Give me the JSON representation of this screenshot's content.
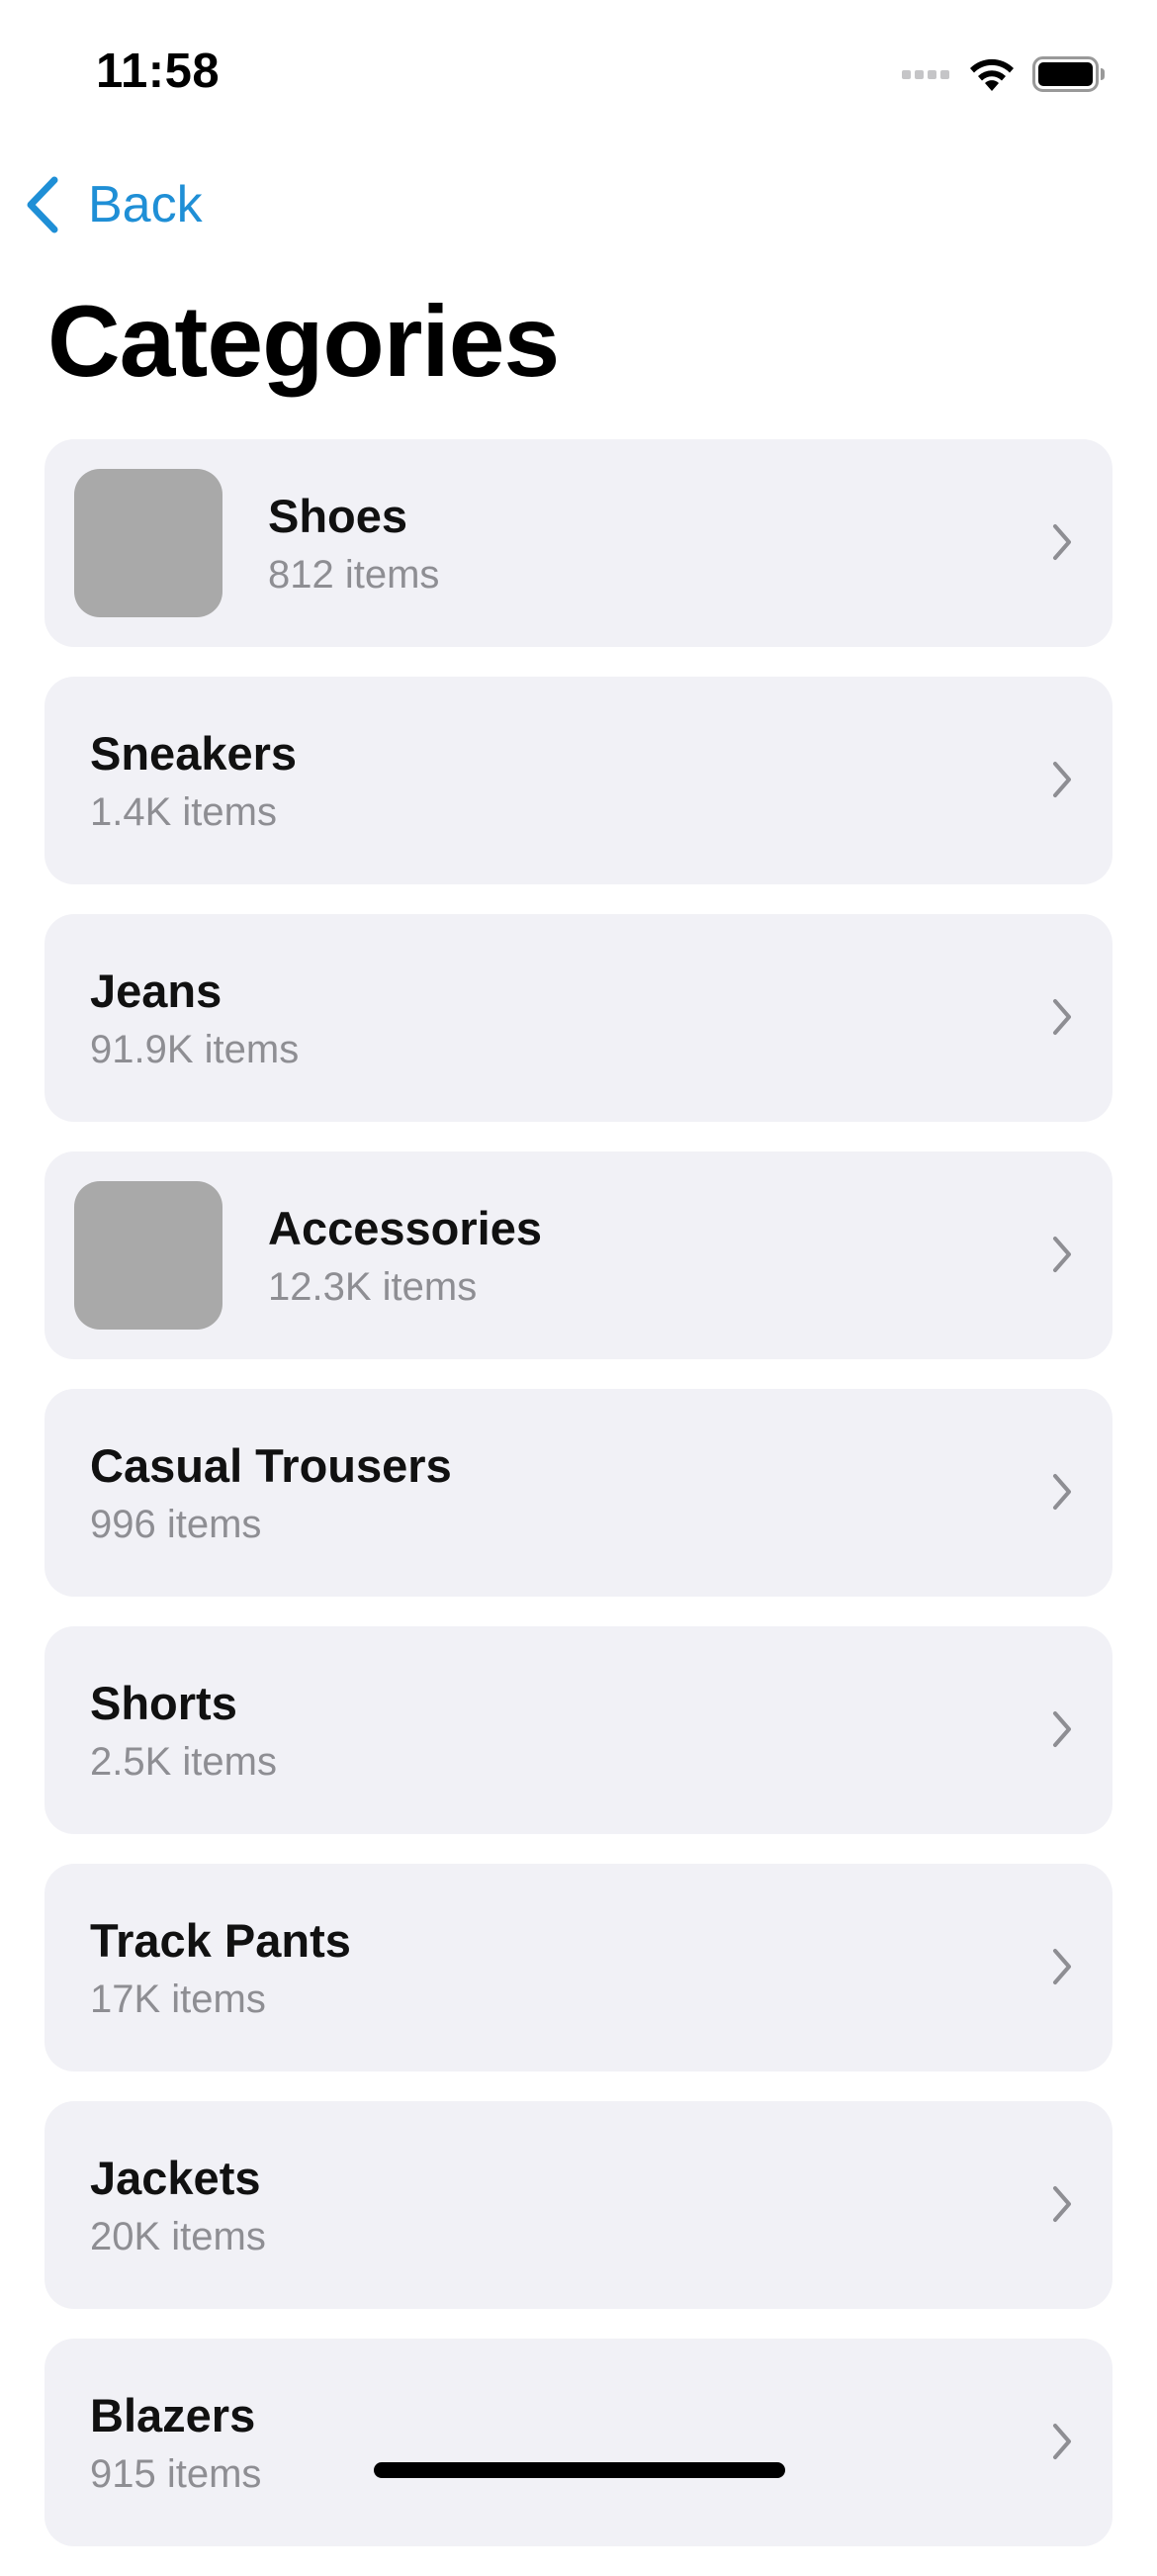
{
  "status_bar": {
    "time": "11:58"
  },
  "nav": {
    "back_label": "Back"
  },
  "page": {
    "title": "Categories"
  },
  "colors": {
    "accent": "#1f8fd6",
    "card_background": "#f1f1f6",
    "thumbnail_placeholder": "#a9a9a9",
    "secondary_text": "#8e8e93"
  },
  "categories": [
    {
      "name": "Shoes",
      "count": "812 items",
      "has_thumbnail": true
    },
    {
      "name": "Sneakers",
      "count": "1.4K items",
      "has_thumbnail": false
    },
    {
      "name": "Jeans",
      "count": "91.9K items",
      "has_thumbnail": false
    },
    {
      "name": "Accessories",
      "count": "12.3K items",
      "has_thumbnail": true
    },
    {
      "name": "Casual Trousers",
      "count": "996 items",
      "has_thumbnail": false
    },
    {
      "name": "Shorts",
      "count": "2.5K items",
      "has_thumbnail": false
    },
    {
      "name": "Track Pants",
      "count": "17K items",
      "has_thumbnail": false
    },
    {
      "name": "Jackets",
      "count": "20K items",
      "has_thumbnail": false
    },
    {
      "name": "Blazers",
      "count": "915 items",
      "has_thumbnail": false
    }
  ]
}
